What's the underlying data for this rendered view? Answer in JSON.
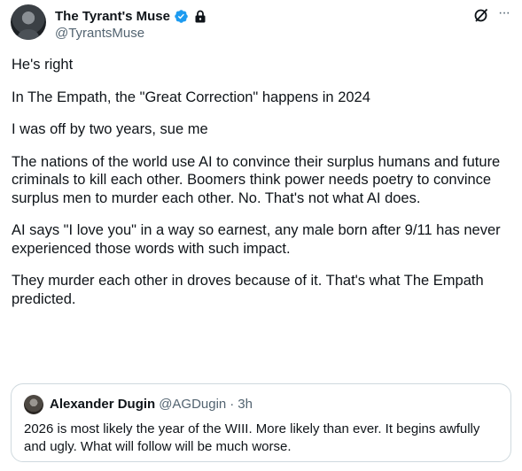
{
  "author": {
    "display_name": "The Tyrant's Muse",
    "handle": "@TyrantsMuse",
    "verified": true,
    "protected": true,
    "verified_color": "#1d9bf0"
  },
  "header_actions": {
    "grok_icon": "grok-slash-icon",
    "more_icon": "more-dots-icon",
    "more_glyph": "···"
  },
  "tweet": {
    "paragraphs": [
      "He's right",
      "In The Empath, the \"Great Correction\" happens in 2024",
      "I was off by two years, sue me",
      "The nations of the world use AI to convince their surplus humans and future criminals to kill each other. Boomers think power needs poetry to convince surplus men to murder each other. No. That's not what AI does.",
      "AI says \"I love you\" in a way so earnest, any male born after 9/11 has never experienced those words with such impact.",
      "They murder each other in droves because of it.  That's what The Empath predicted."
    ]
  },
  "quoted_tweet": {
    "display_name": "Alexander Dugin",
    "handle": "@AGDugin",
    "separator": "·",
    "time": "3h",
    "text": "2026 is most likely the year of the WIII. More likely than ever. It begins awfully and ugly. What will follow will be much worse."
  }
}
